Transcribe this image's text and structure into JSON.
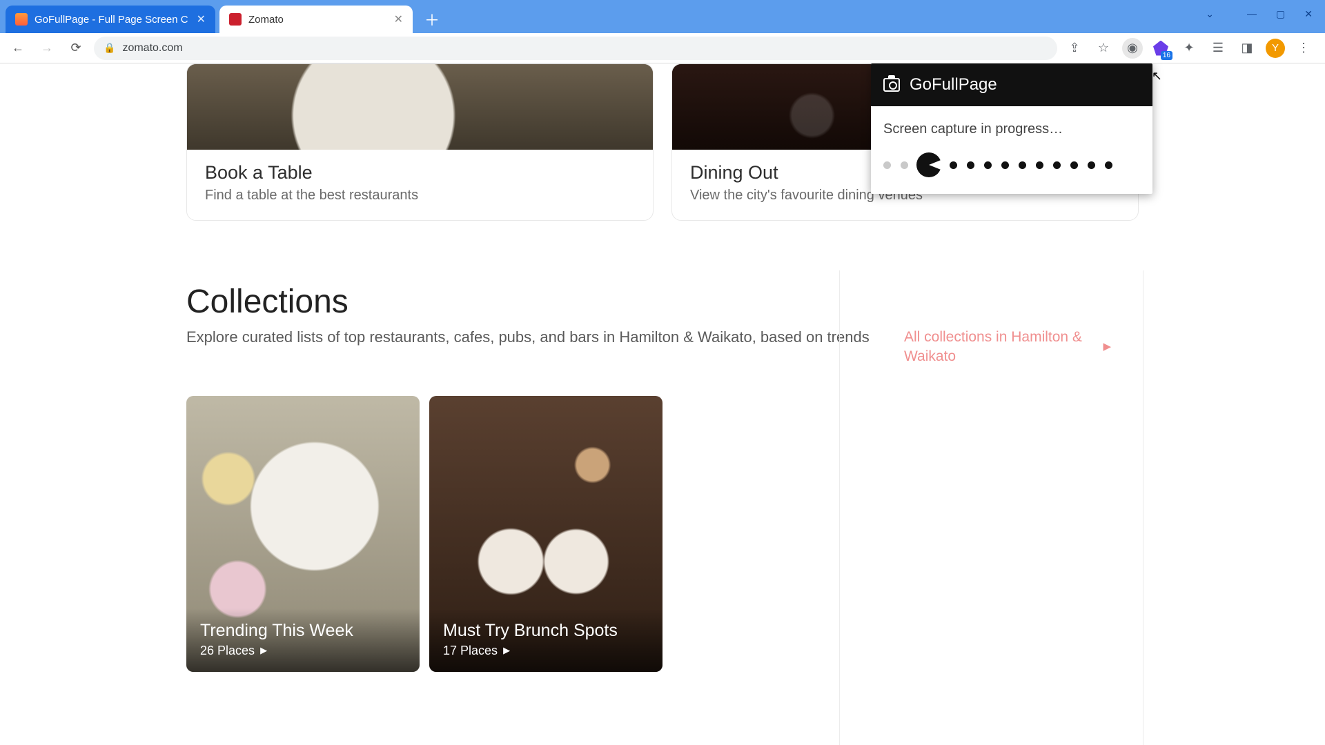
{
  "browser": {
    "tabs": [
      {
        "title": "GoFullPage - Full Page Screen C",
        "active": false
      },
      {
        "title": "Zomato",
        "active": true
      }
    ],
    "url": "zomato.com",
    "avatar_initial": "Y",
    "ext_badge_count": "16"
  },
  "popup": {
    "title": "GoFullPage",
    "message": "Screen capture in progress…"
  },
  "hero": [
    {
      "title": "Book a Table",
      "subtitle": "Find a table at the best restaurants"
    },
    {
      "title": "Dining Out",
      "subtitle": "View the city's favourite dining venues"
    }
  ],
  "collections": {
    "heading": "Collections",
    "subheading": "Explore curated lists of top restaurants, cafes, pubs, and bars in Hamilton & Waikato, based on trends",
    "all_link": "All collections in Hamilton & Waikato",
    "cards": [
      {
        "title": "Trending This Week",
        "places": "26 Places"
      },
      {
        "title": "Must Try Brunch Spots",
        "places": "17 Places"
      }
    ]
  }
}
